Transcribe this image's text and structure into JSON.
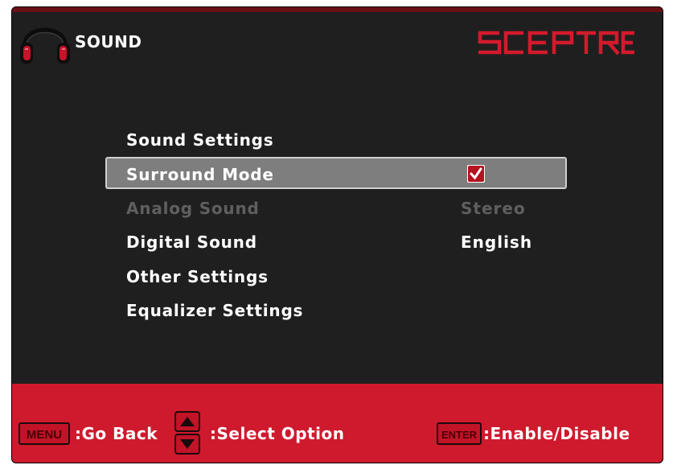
{
  "header": {
    "icon": "headphones-icon",
    "title": "SOUND",
    "brand": "SCEPTRE"
  },
  "menu": {
    "items": [
      {
        "label": "Sound Settings",
        "value": "",
        "state": "normal"
      },
      {
        "label": "Surround Mode",
        "value": "",
        "state": "selected",
        "checked": true
      },
      {
        "label": "Analog Sound",
        "value": "Stereo",
        "state": "disabled"
      },
      {
        "label": "Digital Sound",
        "value": "English",
        "state": "normal"
      },
      {
        "label": "Other Settings",
        "value": "",
        "state": "normal"
      },
      {
        "label": "Equalizer Settings",
        "value": "",
        "state": "normal"
      }
    ]
  },
  "footer": {
    "menu_key": "MENU",
    "menu_action": ":Go Back",
    "select_icon": "up-down-arrows-icon",
    "select_action": ":Select Option",
    "enter_key": "ENTER",
    "enter_action": ":Enable/Disable"
  },
  "colors": {
    "background": "#201f1f",
    "accent_red": "#cf1a2e",
    "selected_row": "#7e7e7e",
    "disabled_text": "#5f5f5f"
  }
}
